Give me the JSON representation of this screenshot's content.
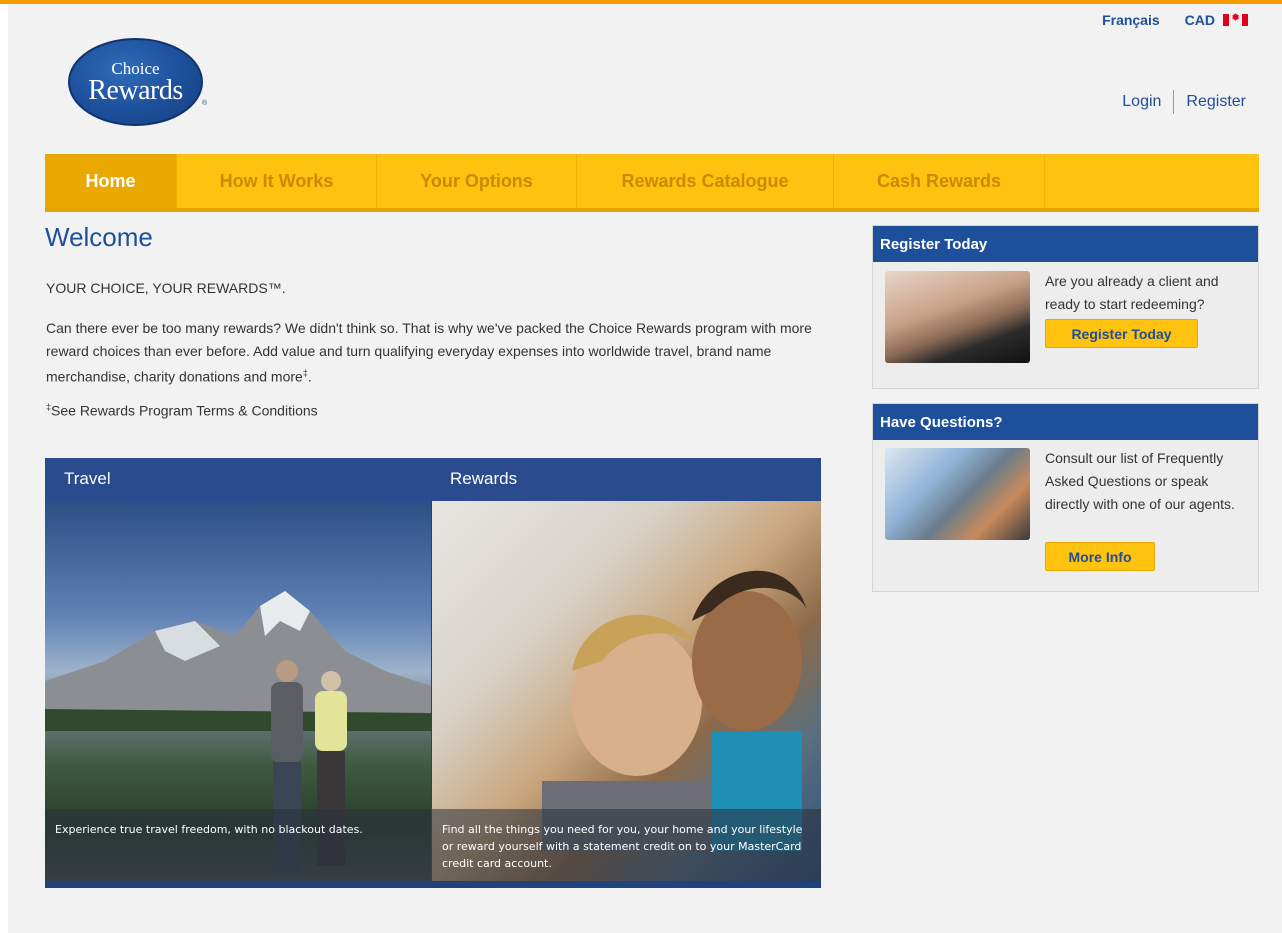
{
  "header": {
    "logo_line1": "Choice",
    "logo_line2": "Rewards",
    "logo_reg": "®",
    "language_link": "Français",
    "currency": "CAD",
    "login": "Login",
    "register": "Register"
  },
  "nav": {
    "items": [
      {
        "label": "Home",
        "active": true
      },
      {
        "label": "How It Works",
        "active": false
      },
      {
        "label": "Your Options",
        "active": false
      },
      {
        "label": "Rewards Catalogue",
        "active": false
      },
      {
        "label": "Cash Rewards",
        "active": false
      }
    ]
  },
  "main": {
    "title": "Welcome",
    "tagline": "YOUR CHOICE, YOUR REWARDS™.",
    "intro": "Can there ever be too many rewards? We didn't think so. That is why we've packed the Choice Rewards program with more reward choices than ever before. Add value and turn qualifying everyday expenses into worldwide travel, brand name merchandise, charity donations and more",
    "intro_sup": "‡",
    "intro_end": ".",
    "terms_sup": "‡",
    "terms": "See Rewards Program Terms & Conditions",
    "promo": {
      "travel_title": "Travel",
      "travel_caption": "Experience true travel freedom, with no blackout dates.",
      "rewards_title": "Rewards",
      "rewards_caption": "Find all the things you need for you, your home and your lifestyle or reward yourself with a statement credit on to your MasterCard credit card account."
    }
  },
  "sidebar": {
    "register_box": {
      "title": "Register Today",
      "text": "Are you already a client and ready to start redeeming?",
      "button": "Register Today"
    },
    "questions_box": {
      "title": "Have Questions?",
      "text": "Consult our list of Frequently Asked Questions or speak directly with one of our agents.",
      "button": "More Info"
    }
  },
  "colors": {
    "brand_blue": "#1d4f9a",
    "nav_yellow": "#ffc20e",
    "top_border_orange": "#f59b00"
  }
}
